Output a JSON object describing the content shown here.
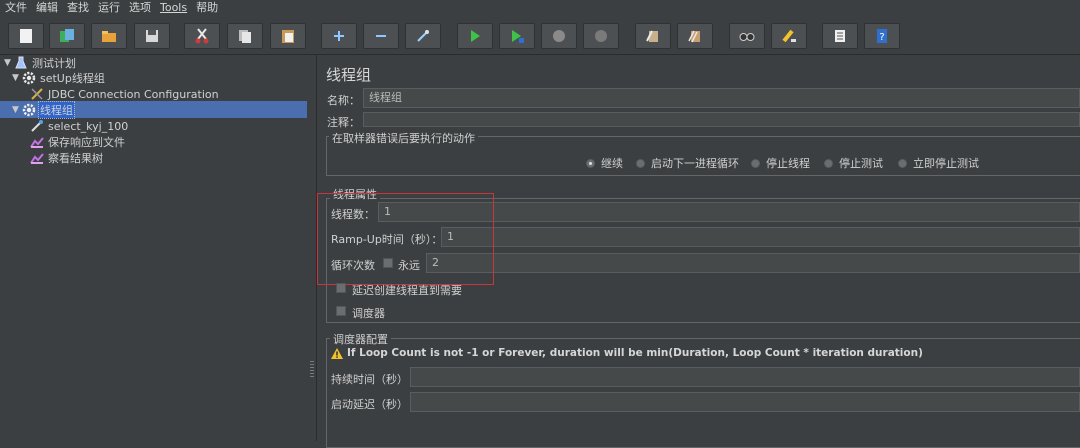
{
  "menu": [
    "文件",
    "编辑",
    "查找",
    "运行",
    "选项",
    "Tools",
    "帮助"
  ],
  "toolbar": [
    {
      "name": "new-icon"
    },
    {
      "name": "templates-icon"
    },
    {
      "name": "open-icon"
    },
    {
      "name": "save-icon"
    },
    {
      "name": "cut-icon"
    },
    {
      "name": "copy-icon"
    },
    {
      "name": "paste-icon"
    },
    {
      "name": "expand-icon"
    },
    {
      "name": "collapse-icon"
    },
    {
      "name": "toggle-icon"
    },
    {
      "name": "start-icon"
    },
    {
      "name": "start-no-pause-icon"
    },
    {
      "name": "stop-icon"
    },
    {
      "name": "shutdown-icon"
    },
    {
      "name": "clear-icon"
    },
    {
      "name": "clear-all-icon"
    },
    {
      "name": "search-icon"
    },
    {
      "name": "reset-search-icon"
    },
    {
      "name": "function-helper-icon"
    },
    {
      "name": "help-icon"
    }
  ],
  "tree": {
    "root": "测试计划",
    "setup": "setUp线程组",
    "jdbc": "JDBC Connection Configuration",
    "group": "线程组",
    "sampler": "select_kyj_100",
    "save_response": "保存响应到文件",
    "result_tree": "察看结果树"
  },
  "panel": {
    "title": "线程组",
    "name_label": "名称：",
    "name_value": "线程组",
    "comment_label": "注释：",
    "comment_value": "",
    "error_action_legend": "在取样器错误后要执行的动作",
    "error_actions": [
      {
        "label": "继续",
        "selected": true
      },
      {
        "label": "启动下一进程循环",
        "selected": false
      },
      {
        "label": "停止线程",
        "selected": false
      },
      {
        "label": "停止测试",
        "selected": false
      },
      {
        "label": "立即停止测试",
        "selected": false
      }
    ],
    "thread_props_legend": "线程属性",
    "threads_label": "线程数：",
    "threads_value": "1",
    "rampup_label": "Ramp-Up时间（秒）：",
    "rampup_value": "1",
    "loop_label": "循环次数",
    "forever_label": "永远",
    "loop_value": "2",
    "delay_create_label": "延迟创建线程直到需要",
    "scheduler_label": "调度器",
    "scheduler_config_legend": "调度器配置",
    "warning": "If Loop Count is not -1 or Forever, duration will be min(Duration, Loop Count * iteration duration)",
    "duration_label": "持续时间（秒）",
    "duration_value": "",
    "startup_delay_label": "启动延迟（秒）",
    "startup_delay_value": ""
  },
  "colors": {
    "accent": "#4b6eaf",
    "highlight_box": "#c8353a",
    "background": "#3c3f41"
  }
}
